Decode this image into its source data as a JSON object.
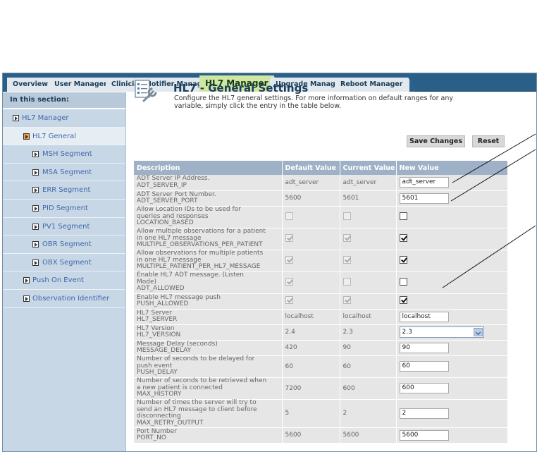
{
  "tabs": [
    {
      "label": "Overview",
      "active": false
    },
    {
      "label": "User Manager",
      "active": false
    },
    {
      "label": "Clinician Notifier Manager",
      "active": false
    },
    {
      "label": "HL7 Manager",
      "active": true
    },
    {
      "label": "Upgrade Manager",
      "active": false
    },
    {
      "label": "Reboot Manager",
      "active": false
    }
  ],
  "sidebar": {
    "heading": "In this section:",
    "items": [
      {
        "label": "HL7 Manager",
        "level": 1
      },
      {
        "label": "HL7 General",
        "level": 2,
        "selected": true
      },
      {
        "label": "MSH Segment",
        "level": 3
      },
      {
        "label": "MSA Segment",
        "level": 3
      },
      {
        "label": "ERR Segment",
        "level": 3
      },
      {
        "label": "PID Segment",
        "level": 3
      },
      {
        "label": "PV1 Segment",
        "level": 3
      },
      {
        "label": "OBR Segment",
        "level": 3
      },
      {
        "label": "OBX Segment",
        "level": 3
      },
      {
        "label": "Push On Event",
        "level": 2
      },
      {
        "label": "Observation Identifier",
        "level": 2
      }
    ]
  },
  "header": {
    "icon": "wrench-checklist-icon",
    "title": "HL7 - General Settings",
    "description": "Configure the HL7 general settings. For more information on default ranges for any variable, simply click the entry in the table below."
  },
  "buttons": {
    "save": "Save Changes",
    "reset": "Reset"
  },
  "table": {
    "columns": [
      "Description",
      "Default Value",
      "Current Value",
      "New Value"
    ],
    "rows": [
      {
        "desc": [
          "ADT Server IP Address.",
          "ADT_SERVER_IP"
        ],
        "default": "adt_server",
        "current": "adt_server",
        "new_type": "text",
        "new_value": "adt_server"
      },
      {
        "desc": [
          "ADT Server Port Number.",
          "ADT_SERVER_PORT"
        ],
        "default": "5600",
        "current": "5601",
        "new_type": "text",
        "new_value": "5601"
      },
      {
        "desc": [
          "Allow Location IDs to be used for",
          "queries and responses",
          "LOCATION_BASED"
        ],
        "default_checked": false,
        "current_checked": false,
        "new_type": "checkbox",
        "new_checked": false
      },
      {
        "desc": [
          "Allow multiple observations for a patient",
          "in one HL7 message",
          "MULTIPLE_OBSERVATIONS_PER_PATIENT"
        ],
        "default_checked": true,
        "current_checked": true,
        "new_type": "checkbox",
        "new_checked": true
      },
      {
        "desc": [
          "Allow observations for multiple patients",
          "in one HL7 message",
          "MULTIPLE_PATIENT_PER_HL7_MESSAGE"
        ],
        "default_checked": true,
        "current_checked": true,
        "new_type": "checkbox",
        "new_checked": true
      },
      {
        "desc": [
          "Enable HL7 ADT message. (Listen",
          "Mode)",
          "ADT_ALLOWED"
        ],
        "default_checked": true,
        "current_checked": false,
        "new_type": "checkbox",
        "new_checked": false
      },
      {
        "desc": [
          "Enable HL7 message push",
          "PUSH_ALLOWED"
        ],
        "default_checked": true,
        "current_checked": true,
        "new_type": "checkbox",
        "new_checked": true
      },
      {
        "desc": [
          "HL7 Server",
          "HL7_SERVER"
        ],
        "default": "localhost",
        "current": "localhost",
        "new_type": "text",
        "new_value": "localhost"
      },
      {
        "desc": [
          "HL7 Version",
          "HL7_VERSION"
        ],
        "default": "2.4",
        "current": "2.3",
        "new_type": "select",
        "new_value": "2.3"
      },
      {
        "desc": [
          "Message Delay (seconds)",
          "MESSAGE_DELAY"
        ],
        "default": "420",
        "current": "90",
        "new_type": "text",
        "new_value": "90"
      },
      {
        "desc": [
          "Number of seconds to be delayed for",
          "push event",
          "PUSH_DELAY"
        ],
        "default": "60",
        "current": "60",
        "new_type": "text",
        "new_value": "60"
      },
      {
        "desc": [
          "Number of seconds to be retrieved when",
          "a new patient is connected",
          "MAX_HISTORY"
        ],
        "default": "7200",
        "current": "600",
        "new_type": "text",
        "new_value": "600"
      },
      {
        "desc": [
          "Number of times the server will try to",
          "send an HL7 message to client before",
          "disconnecting",
          "MAX_RETRY_OUTPUT"
        ],
        "default": "5",
        "current": "2",
        "new_type": "text",
        "new_value": "2"
      },
      {
        "desc": [
          "Port Number",
          "PORT_NO"
        ],
        "default": "5600",
        "current": "5600",
        "new_type": "text",
        "new_value": "5600"
      }
    ]
  },
  "colors": {
    "tabbar": "#2a5f88",
    "active_tab": "#cfe6a4",
    "sidebar": "#c7d7e5",
    "table_header": "#9eb1c6",
    "link": "#4168aa"
  }
}
